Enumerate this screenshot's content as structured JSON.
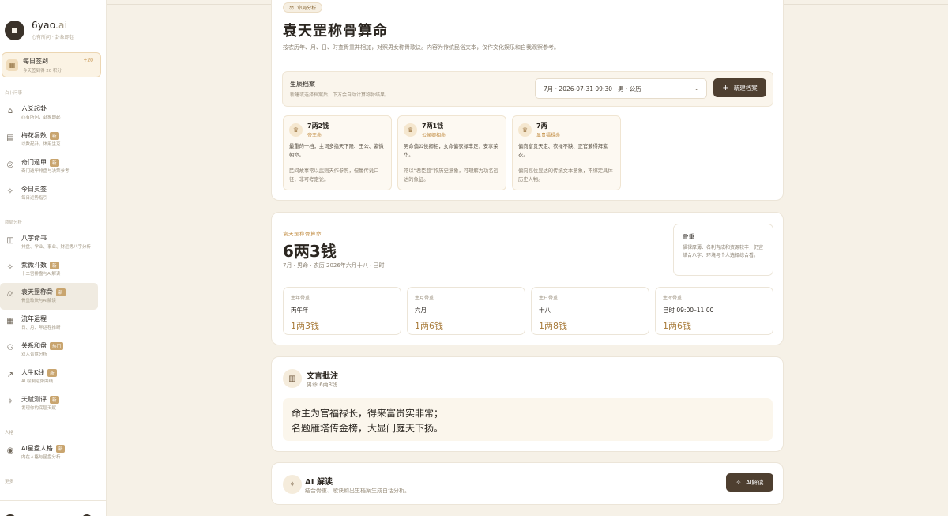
{
  "sidebar": {
    "brand": "6yao",
    "brand_suffix": ".ai",
    "brand_sub": "心有所问 · 卦象即起",
    "checkin": {
      "title": "每日签到",
      "sub": "今天签到得 20 积分",
      "plus": "+20"
    },
    "section1": "占卜问事",
    "section2": "命局分析",
    "section3": "人格",
    "section4": "更多",
    "items": [
      {
        "title": "六爻起卦",
        "sub": "心有所问，卦象即起",
        "badge": ""
      },
      {
        "title": "梅花易数",
        "sub": "以数起卦，体用生克",
        "badge": "新"
      },
      {
        "title": "奇门遁甲",
        "sub": "奇门遁甲排盘与决策参考",
        "badge": "新"
      },
      {
        "title": "今日灵签",
        "sub": "每日运势指引",
        "badge": ""
      },
      {
        "title": "八字命书",
        "sub": "排盘、学业、事业、财运等八字分析",
        "badge": ""
      },
      {
        "title": "紫微斗数",
        "sub": "十二宫排盘与AI解读",
        "badge": "新"
      },
      {
        "title": "袁天罡称骨",
        "sub": "骨重歌诀与AI解读",
        "badge": "新"
      },
      {
        "title": "流年运程",
        "sub": "日、月、年运程推断",
        "badge": ""
      },
      {
        "title": "关系和盘",
        "sub": "双人合盘分析",
        "badge": "热门"
      },
      {
        "title": "人生K线",
        "sub": "AI 绘制运势曲线",
        "badge": "新"
      },
      {
        "title": "天赋测评",
        "sub": "发现你的底层天赋",
        "badge": "新"
      },
      {
        "title": "AI星盘人格",
        "sub": "内在人格与星盘分析",
        "badge": "新"
      }
    ]
  },
  "intro": {
    "tag": "命局分析",
    "title": "袁天罡称骨算命",
    "desc": "按农历年、月、日、时查骨重并相加，对照男女称骨歌诀。内容为传统民俗文本，仅作文化娱乐和自我观察参考。",
    "profile_title": "生辰档案",
    "profile_sub": "新建或选择档案后，下方会自动计算称骨结果。",
    "profile_select": "7月 · 2026-07-31 09:30 · 男 · 公历",
    "new_button": "新建档案"
  },
  "readings": [
    {
      "value": "7两2钱",
      "name": "帝王命",
      "body": "最重的一档，主词多指天下隆、王公、紫微朝命。",
      "note": "民间故事常以武则天作参照，但属传说口径，非可考定论。"
    },
    {
      "value": "7两1钱",
      "name": "公侯卿相命",
      "body": "男命偏公侯卿相，女命偏衣禄丰足，安享荣华。",
      "note": "常以“君臣超”作历史意象，可理解为功名远达的象征。"
    },
    {
      "value": "7两",
      "name": "显贵福禄命",
      "body": "偏向富贵天定、衣禄不缺、正官兼得拜紫衣。",
      "note": "偏向高位显达的传统文本意象，不绑定具体历史人物。"
    }
  ],
  "result": {
    "eyebrow": "袁天罡称骨算命",
    "total": "6两3钱",
    "meta": "7月 · 男命 · 农历 2026年六月十八 · 巳时",
    "note_title": "骨重",
    "note_body": "福禄厚薄、名利有成和资源较丰，仍宜结合八字、环境与个人选择综合看。",
    "weights": [
      {
        "label": "生年骨重",
        "value": "丙午年",
        "amount": "1两3钱"
      },
      {
        "label": "生月骨重",
        "value": "六月",
        "amount": "1两6钱"
      },
      {
        "label": "生日骨重",
        "value": "十八",
        "amount": "1两8钱"
      },
      {
        "label": "生时骨重",
        "value": "巳时 09:00–11:00",
        "amount": "1两6钱"
      }
    ]
  },
  "annotation": {
    "title": "文言批注",
    "sub": "男命 6两3钱",
    "line1": "命主为官福禄长，得来富贵实非常；",
    "line2": "名题雁塔传金榜，大显门庭天下扬。"
  },
  "ai": {
    "title": "AI 解读",
    "sub": "结合骨重、歌诀和出生档案生成白话分析。",
    "button": "AI解读"
  },
  "colors": {
    "accent": "#c08a3e",
    "dark_button": "#4e3f30",
    "background": "#f6f1e7"
  }
}
